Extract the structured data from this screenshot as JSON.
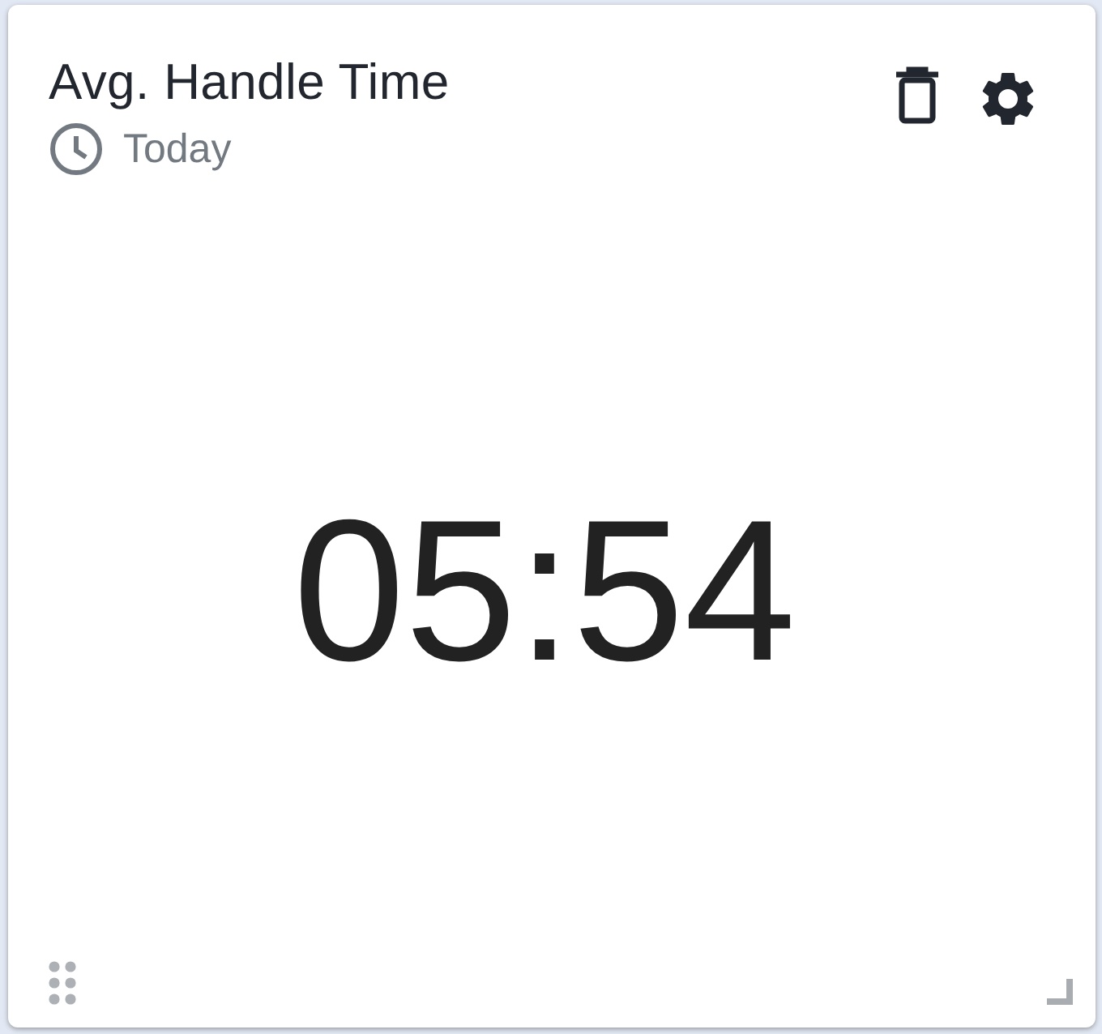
{
  "widget": {
    "title": "Avg. Handle Time",
    "period": "Today",
    "value": "05:54"
  }
}
